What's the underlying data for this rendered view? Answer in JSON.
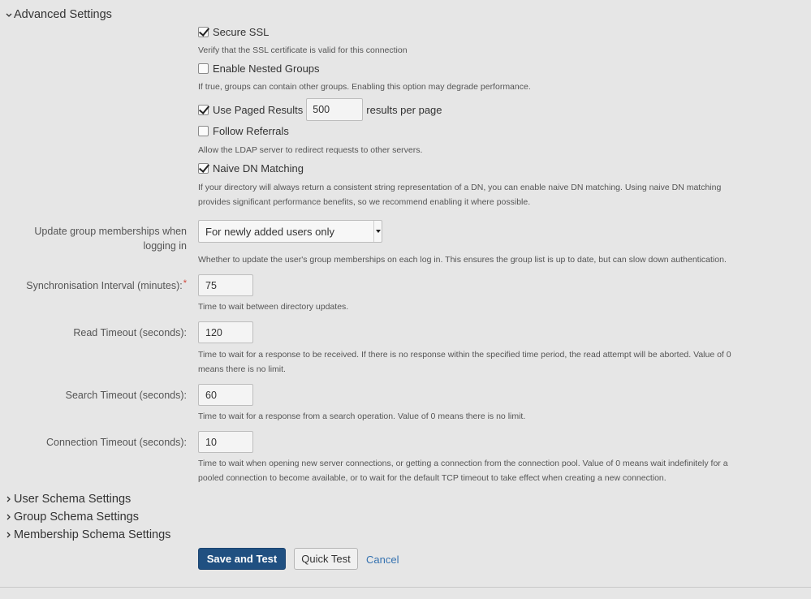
{
  "sections": {
    "advanced": "Advanced Settings",
    "user_schema": "User Schema Settings",
    "group_schema": "Group Schema Settings",
    "membership_schema": "Membership Schema Settings"
  },
  "checkboxes": {
    "secure_ssl": {
      "label": "Secure SSL",
      "checked": true,
      "description": "Verify that the SSL certificate is valid for this connection"
    },
    "nested_groups": {
      "label": "Enable Nested Groups",
      "checked": false,
      "description": "If true, groups can contain other groups. Enabling this option may degrade performance."
    },
    "paged_results": {
      "label": "Use Paged Results",
      "checked": true,
      "value": "500",
      "suffix": "results per page"
    },
    "follow_referrals": {
      "label": "Follow Referrals",
      "checked": false,
      "description": "Allow the LDAP server to redirect requests to other servers."
    },
    "naive_dn": {
      "label": "Naive DN Matching",
      "checked": true,
      "description_line1": "If your directory will always return a consistent string representation of a DN, you can enable naive DN matching. Using naive DN matching",
      "description_line2": "provides significant performance benefits, so we recommend enabling it where possible."
    }
  },
  "update_memberships": {
    "label_line1": "Update group memberships when",
    "label_line2": "logging in",
    "selected": "For newly added users only",
    "description": "Whether to update the user's group memberships on each log in. This ensures the group list is up to date, but can slow down authentication."
  },
  "sync_interval": {
    "label": "Synchronisation Interval (minutes):",
    "required_marker": "*",
    "value": "75",
    "description": "Time to wait between directory updates."
  },
  "read_timeout": {
    "label": "Read Timeout (seconds):",
    "value": "120",
    "description_line1": "Time to wait for a response to be received. If there is no response within the specified time period, the read attempt will be aborted. Value of 0",
    "description_line2": "means there is no limit."
  },
  "search_timeout": {
    "label": "Search Timeout (seconds):",
    "value": "60",
    "description": "Time to wait for a response from a search operation. Value of 0 means there is no limit."
  },
  "connection_timeout": {
    "label": "Connection Timeout (seconds):",
    "value": "10",
    "description_line1": "Time to wait when opening new server connections, or getting a connection from the connection pool. Value of 0 means wait indefinitely for a",
    "description_line2": "pooled connection to become available, or to wait for the default TCP timeout to take effect when creating a new connection."
  },
  "buttons": {
    "save_test": "Save and Test",
    "quick_test": "Quick Test",
    "cancel": "Cancel"
  },
  "colors": {
    "primary_button": "#205081",
    "link": "#3572b0",
    "required": "#d04437"
  }
}
